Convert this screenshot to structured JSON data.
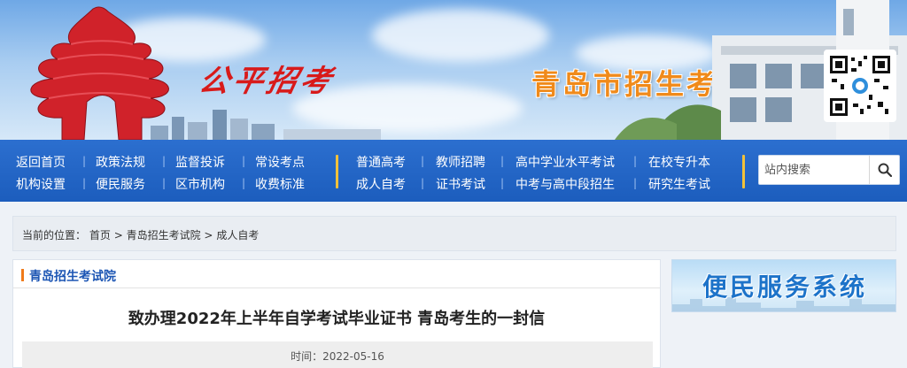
{
  "header": {
    "calligraphy": "公平招考",
    "site_title": "青岛市招生考试院"
  },
  "nav": {
    "left": [
      [
        "返回首页",
        "政策法规",
        "监督投诉",
        "常设考点"
      ],
      [
        "机构设置",
        "便民服务",
        "区市机构",
        "收费标准"
      ]
    ],
    "right": [
      [
        "普通高考",
        "教师招聘",
        "高中学业水平考试",
        "在校专升本"
      ],
      [
        "成人自考",
        "证书考试",
        "中考与高中段招生",
        "研究生考试"
      ]
    ]
  },
  "search": {
    "placeholder": "站内搜索"
  },
  "breadcrumb": {
    "prefix": "当前的位置：",
    "items": [
      "首页",
      "青岛招生考试院",
      "成人自考"
    ],
    "separator": ">"
  },
  "section": {
    "title": "青岛招生考试院"
  },
  "article": {
    "title": "致办理2022年上半年自学考试毕业证书 青岛考生的一封信",
    "time_label": "时间：",
    "time": "2022-05-16"
  },
  "sidebar": {
    "service_title": "便民服务系统"
  },
  "colors": {
    "nav_bg": "#2062c4",
    "title_orange": "#f08a1a",
    "accent_yellow": "#f1c13a",
    "link_blue": "#1d56b4"
  }
}
